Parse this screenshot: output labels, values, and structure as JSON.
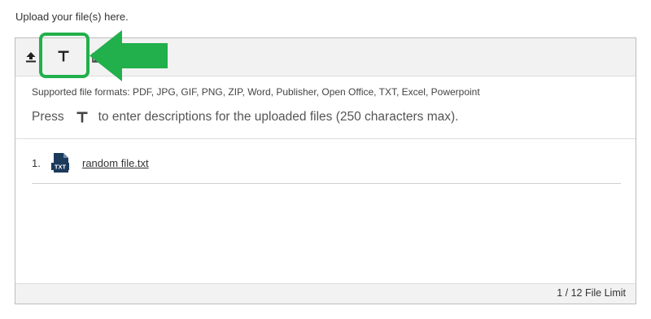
{
  "intro_text": "Upload your file(s) here.",
  "toolbar": {
    "upload_icon": "upload-icon",
    "description_icon": "text-T-icon",
    "extra_icon": "image-icon"
  },
  "info": {
    "formats": "Supported file formats: PDF, JPG, GIF, PNG, ZIP, Word, Publisher, Open Office, TXT, Excel, Powerpoint",
    "press_before": "Press",
    "press_after": "to enter descriptions for the uploaded files (250 characters max)."
  },
  "files": [
    {
      "number": "1.",
      "icon_label": "TXT",
      "name": "random file.txt"
    }
  ],
  "footer": {
    "limit": "1 / 12 File Limit"
  },
  "annotation": {
    "color": "#21b04b"
  }
}
